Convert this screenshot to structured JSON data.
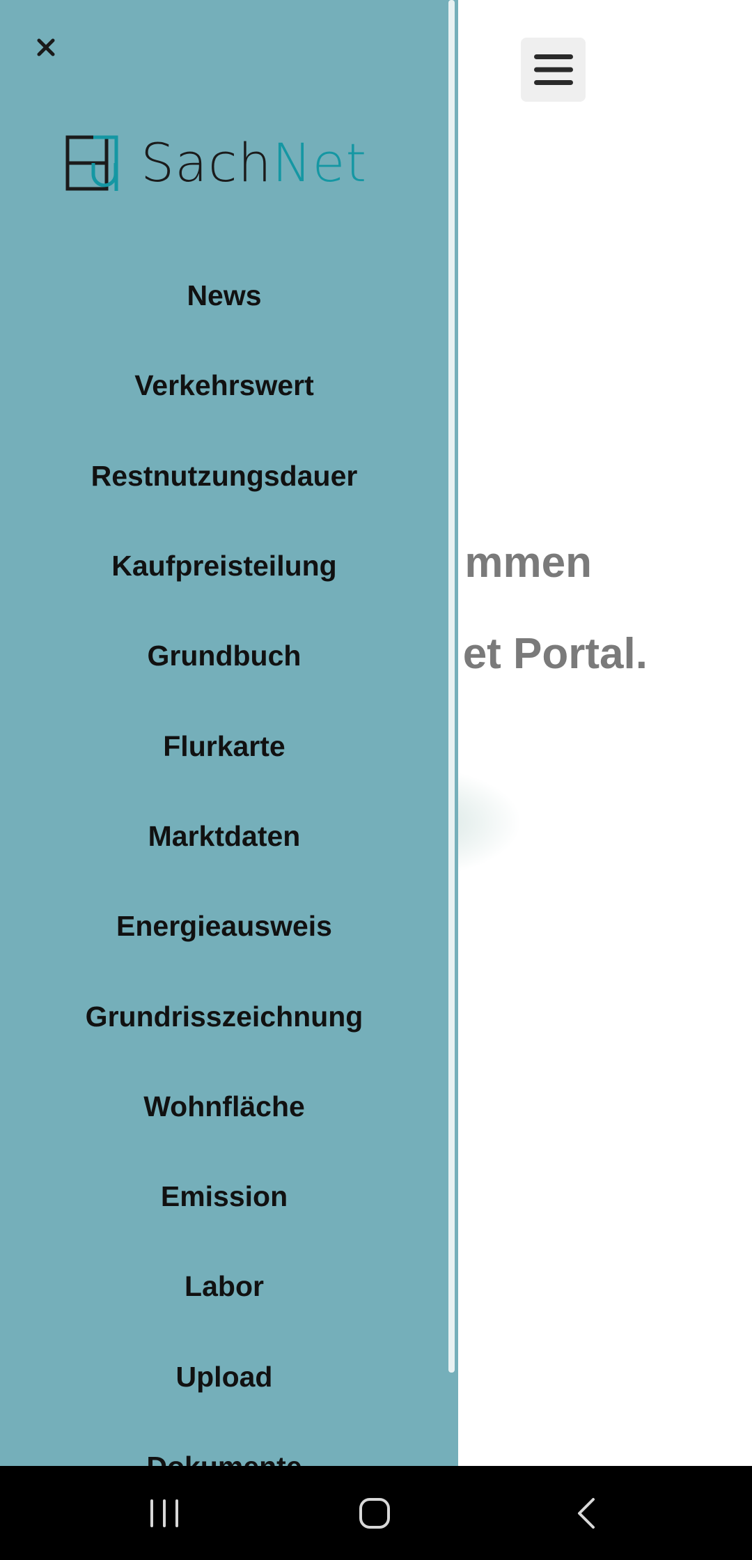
{
  "background_page": {
    "welcome_line1": "mmen",
    "welcome_line2": "et Portal."
  },
  "drawer": {
    "logo": {
      "text_part1": "Sach",
      "text_part2": "Net",
      "mark_icon": "sachnet-logo-mark",
      "colors": {
        "dark": "#1b1b1b",
        "accent": "#1597a3"
      }
    },
    "menu_items": [
      "News",
      "Verkehrswert",
      "Restnutzungsdauer",
      "Kaufpreisteilung",
      "Grundbuch",
      "Flurkarte",
      "Marktdaten",
      "Energieausweis",
      "Grundrisszeichnung",
      "Wohnfläche",
      "Emission",
      "Labor",
      "Upload",
      "Dokumente"
    ],
    "background_color": "#75afba"
  },
  "icons": {
    "close": "close-icon",
    "menu": "hamburger-menu-icon",
    "recents": "recents-icon",
    "home": "home-icon",
    "back": "back-icon"
  }
}
